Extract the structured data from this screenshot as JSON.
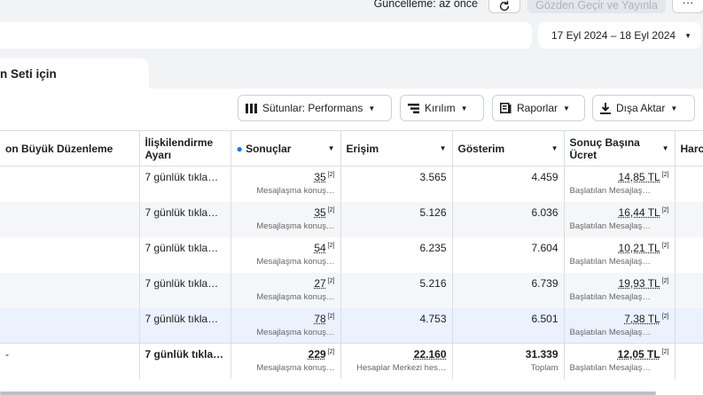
{
  "header": {
    "updated_text": "Güncelleme: az önce",
    "publish_label": "Gözden Geçir ve Yayınla",
    "more_label": "···"
  },
  "date_range": "17 Eyl 2024 – 18 Eyl 2024",
  "tab_label": "n Seti için",
  "toolbar": {
    "columns_label": "Sütunlar: Performans",
    "breakdown_label": "Kırılım",
    "reports_label": "Raporlar",
    "export_label": "Dışa Aktar"
  },
  "table": {
    "columns": {
      "edit": "on Büyük Düzenleme",
      "attribution": "İlişkilendirme Ayarı",
      "results": "Sonuçlar",
      "reach": "Erişim",
      "impressions": "Gösterim",
      "cost": "Sonuç Başına Ücret",
      "extra": "Harc"
    },
    "rows": [
      {
        "attribution": "7 günlük tıkla…",
        "results": "35",
        "results_sub": "Mesajlaşma konuş…",
        "reach": "3.565",
        "impressions": "4.459",
        "cost": "14,85 TL",
        "cost_sub": "Başlatılan Mesajlaş…"
      },
      {
        "attribution": "7 günlük tıkla…",
        "results": "35",
        "results_sub": "Mesajlaşma konuş…",
        "reach": "5.126",
        "impressions": "6.036",
        "cost": "16,44 TL",
        "cost_sub": "Başlatılan Mesajlaş…"
      },
      {
        "attribution": "7 günlük tıkla…",
        "results": "54",
        "results_sub": "Mesajlaşma konuş…",
        "reach": "6.235",
        "impressions": "7.604",
        "cost": "10,21 TL",
        "cost_sub": "Başlatılan Mesajlaş…"
      },
      {
        "attribution": "7 günlük tıkla…",
        "results": "27",
        "results_sub": "Mesajlaşma konuş…",
        "reach": "5.216",
        "impressions": "6.739",
        "cost": "19,93 TL",
        "cost_sub": "Başlatılan Mesajlaş…"
      },
      {
        "attribution": "7 günlük tıkla…",
        "results": "78",
        "results_sub": "Mesajlaşma konuş…",
        "reach": "4.753",
        "impressions": "6.501",
        "cost": "7,38 TL",
        "cost_sub": "Başlatılan Mesajlaş…"
      }
    ],
    "total": {
      "edit": "-",
      "attribution": "7 günlük tıkla…",
      "results": "229",
      "results_sub": "Mesajlaşma konuş…",
      "reach": "22.160",
      "reach_sub": "Hesaplar Merkezi hes…",
      "impressions": "31.339",
      "impressions_sub": "Toplam",
      "cost": "12,05 TL",
      "cost_sub": "Başlatılan Mesajlaş…"
    },
    "footnote": "[2]"
  }
}
